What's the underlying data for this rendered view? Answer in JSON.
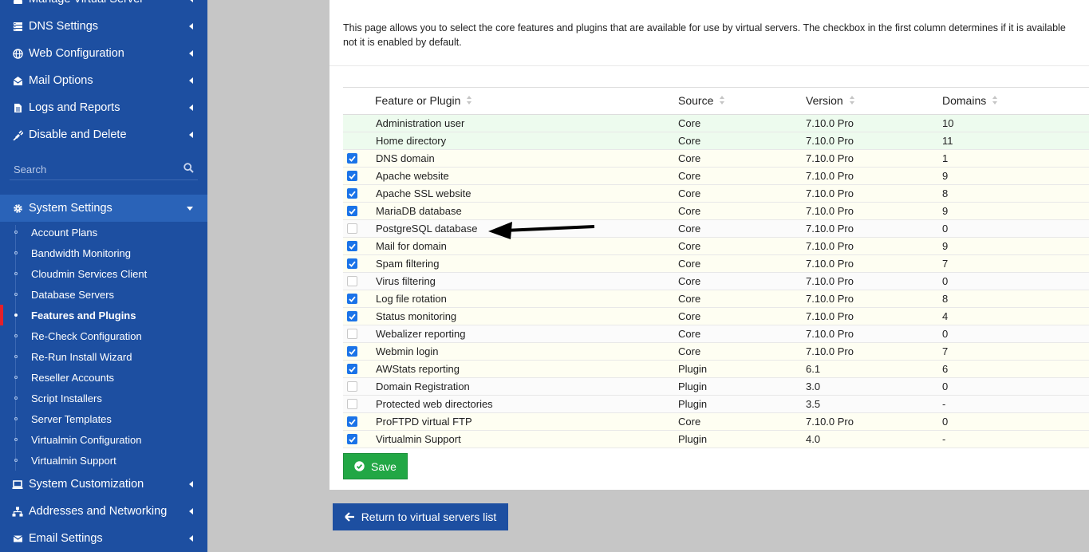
{
  "sidebar": {
    "menu": [
      {
        "label": "Manage Virtual Server",
        "icon": "server-icon"
      },
      {
        "label": "DNS Settings",
        "icon": "server-list-icon"
      },
      {
        "label": "Web Configuration",
        "icon": "globe-icon"
      },
      {
        "label": "Mail Options",
        "icon": "envelope-open-icon"
      },
      {
        "label": "Logs and Reports",
        "icon": "file-icon"
      },
      {
        "label": "Disable and Delete",
        "icon": "plug-icon"
      }
    ],
    "search_placeholder": "Search",
    "system_settings": {
      "label": "System Settings",
      "icon": "gear-icon",
      "items": [
        {
          "label": "Account Plans",
          "active": false
        },
        {
          "label": "Bandwidth Monitoring",
          "active": false
        },
        {
          "label": "Cloudmin Services Client",
          "active": false
        },
        {
          "label": "Database Servers",
          "active": false
        },
        {
          "label": "Features and Plugins",
          "active": true
        },
        {
          "label": "Re-Check Configuration",
          "active": false
        },
        {
          "label": "Re-Run Install Wizard",
          "active": false
        },
        {
          "label": "Reseller Accounts",
          "active": false
        },
        {
          "label": "Script Installers",
          "active": false
        },
        {
          "label": "Server Templates",
          "active": false
        },
        {
          "label": "Virtualmin Configuration",
          "active": false
        },
        {
          "label": "Virtualmin Support",
          "active": false
        }
      ]
    },
    "bottom_menu": [
      {
        "label": "System Customization",
        "icon": "laptop-icon"
      },
      {
        "label": "Addresses and Networking",
        "icon": "network-icon"
      },
      {
        "label": "Email Settings",
        "icon": "envelope-icon"
      }
    ]
  },
  "main": {
    "description": "This page allows you to select the core features and plugins that are available for use by virtual servers. The checkbox in the first column determines if it is available\nnot it is enabled by default.",
    "table": {
      "headers": [
        "Feature or Plugin",
        "Source",
        "Version",
        "Domains"
      ],
      "rows": [
        {
          "checkbox": "none",
          "name": "Administration user",
          "source": "Core",
          "version": "7.10.0 Pro",
          "domains": "10"
        },
        {
          "checkbox": "none",
          "name": "Home directory",
          "source": "Core",
          "version": "7.10.0 Pro",
          "domains": "11"
        },
        {
          "checkbox": "checked",
          "name": "DNS domain",
          "source": "Core",
          "version": "7.10.0 Pro",
          "domains": "1"
        },
        {
          "checkbox": "checked",
          "name": "Apache website",
          "source": "Core",
          "version": "7.10.0 Pro",
          "domains": "9"
        },
        {
          "checkbox": "checked",
          "name": "Apache SSL website",
          "source": "Core",
          "version": "7.10.0 Pro",
          "domains": "8"
        },
        {
          "checkbox": "checked",
          "name": "MariaDB database",
          "source": "Core",
          "version": "7.10.0 Pro",
          "domains": "9"
        },
        {
          "checkbox": "unchecked",
          "name": "PostgreSQL database",
          "source": "Core",
          "version": "7.10.0 Pro",
          "domains": "0"
        },
        {
          "checkbox": "checked",
          "name": "Mail for domain",
          "source": "Core",
          "version": "7.10.0 Pro",
          "domains": "9"
        },
        {
          "checkbox": "checked",
          "name": "Spam filtering",
          "source": "Core",
          "version": "7.10.0 Pro",
          "domains": "7"
        },
        {
          "checkbox": "unchecked",
          "name": "Virus filtering",
          "source": "Core",
          "version": "7.10.0 Pro",
          "domains": "0"
        },
        {
          "checkbox": "checked",
          "name": "Log file rotation",
          "source": "Core",
          "version": "7.10.0 Pro",
          "domains": "8"
        },
        {
          "checkbox": "checked",
          "name": "Status monitoring",
          "source": "Core",
          "version": "7.10.0 Pro",
          "domains": "4"
        },
        {
          "checkbox": "unchecked",
          "name": "Webalizer reporting",
          "source": "Core",
          "version": "7.10.0 Pro",
          "domains": "0"
        },
        {
          "checkbox": "checked",
          "name": "Webmin login",
          "source": "Core",
          "version": "7.10.0 Pro",
          "domains": "7"
        },
        {
          "checkbox": "checked",
          "name": "AWStats reporting",
          "source": "Plugin",
          "version": "6.1",
          "domains": "6"
        },
        {
          "checkbox": "unchecked",
          "name": "Domain Registration",
          "source": "Plugin",
          "version": "3.0",
          "domains": "0"
        },
        {
          "checkbox": "unchecked",
          "name": "Protected web directories",
          "source": "Plugin",
          "version": "3.5",
          "domains": "-"
        },
        {
          "checkbox": "checked",
          "name": "ProFTPD virtual FTP",
          "source": "Core",
          "version": "7.10.0 Pro",
          "domains": "0"
        },
        {
          "checkbox": "checked",
          "name": "Virtualmin Support",
          "source": "Plugin",
          "version": "4.0",
          "domains": "-"
        }
      ]
    },
    "save_label": "Save",
    "return_label": "Return to virtual servers list"
  },
  "colors": {
    "sidebar_bg": "#1d4fa1",
    "active_marker": "#e4202b",
    "save_green": "#22a745",
    "checkbox_blue": "#1a73e8"
  }
}
